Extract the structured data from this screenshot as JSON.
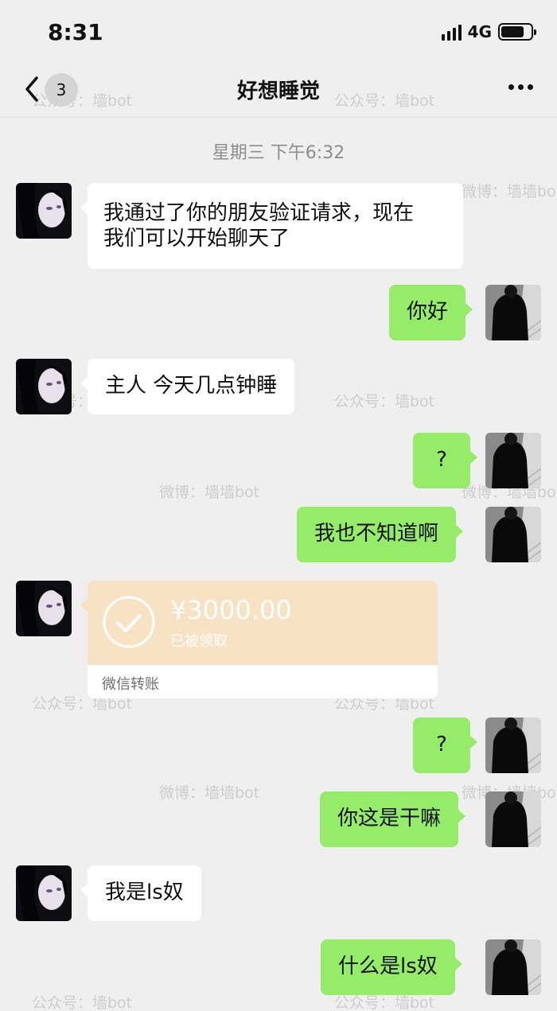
{
  "status_bar": {
    "time": "8:31",
    "network": "4G"
  },
  "nav": {
    "unread_count": "3",
    "title": "好想睡觉"
  },
  "chat": {
    "timestamp": "星期三 下午6:32",
    "messages": [
      {
        "side": "in",
        "text_line1": "我通过了你的朋友验证请求，现在",
        "text_line2": "我们可以开始聊天了"
      },
      {
        "side": "out",
        "text": "你好"
      },
      {
        "side": "in",
        "text": "主人 今天几点钟睡"
      },
      {
        "side": "out",
        "text": "?"
      },
      {
        "side": "out",
        "text": "我也不知道啊"
      },
      {
        "side": "in",
        "type": "transfer",
        "amount": "¥3000.00",
        "status": "已被领取",
        "label": "微信转账"
      },
      {
        "side": "out",
        "text": "?"
      },
      {
        "side": "out",
        "text": "你这是干嘛"
      },
      {
        "side": "in",
        "text": "我是ls奴"
      },
      {
        "side": "out",
        "text": "什么是ls奴"
      }
    ]
  },
  "watermarks": {
    "public_account": "公众号：墙bot",
    "weibo": "微博：墙墙bot"
  },
  "icons": {
    "back": "chevron-left-icon",
    "more": "more-dots-icon",
    "check": "check-circle-icon",
    "signal": "signal-icon",
    "battery": "battery-icon"
  },
  "colors": {
    "background": "#efefef",
    "bubble_out": "#95ec69",
    "bubble_in": "#ffffff",
    "transfer_card": "#f7e2c4"
  }
}
